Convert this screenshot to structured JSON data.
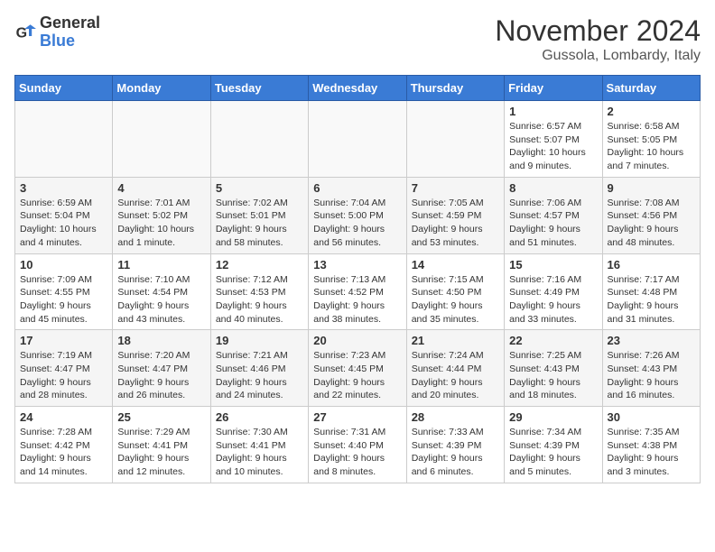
{
  "logo": {
    "line1": "General",
    "line2": "Blue"
  },
  "calendar": {
    "title": "November 2024",
    "subtitle": "Gussola, Lombardy, Italy"
  },
  "headers": [
    "Sunday",
    "Monday",
    "Tuesday",
    "Wednesday",
    "Thursday",
    "Friday",
    "Saturday"
  ],
  "weeks": [
    [
      {
        "day": "",
        "info": ""
      },
      {
        "day": "",
        "info": ""
      },
      {
        "day": "",
        "info": ""
      },
      {
        "day": "",
        "info": ""
      },
      {
        "day": "",
        "info": ""
      },
      {
        "day": "1",
        "info": "Sunrise: 6:57 AM\nSunset: 5:07 PM\nDaylight: 10 hours and 9 minutes."
      },
      {
        "day": "2",
        "info": "Sunrise: 6:58 AM\nSunset: 5:05 PM\nDaylight: 10 hours and 7 minutes."
      }
    ],
    [
      {
        "day": "3",
        "info": "Sunrise: 6:59 AM\nSunset: 5:04 PM\nDaylight: 10 hours and 4 minutes."
      },
      {
        "day": "4",
        "info": "Sunrise: 7:01 AM\nSunset: 5:02 PM\nDaylight: 10 hours and 1 minute."
      },
      {
        "day": "5",
        "info": "Sunrise: 7:02 AM\nSunset: 5:01 PM\nDaylight: 9 hours and 58 minutes."
      },
      {
        "day": "6",
        "info": "Sunrise: 7:04 AM\nSunset: 5:00 PM\nDaylight: 9 hours and 56 minutes."
      },
      {
        "day": "7",
        "info": "Sunrise: 7:05 AM\nSunset: 4:59 PM\nDaylight: 9 hours and 53 minutes."
      },
      {
        "day": "8",
        "info": "Sunrise: 7:06 AM\nSunset: 4:57 PM\nDaylight: 9 hours and 51 minutes."
      },
      {
        "day": "9",
        "info": "Sunrise: 7:08 AM\nSunset: 4:56 PM\nDaylight: 9 hours and 48 minutes."
      }
    ],
    [
      {
        "day": "10",
        "info": "Sunrise: 7:09 AM\nSunset: 4:55 PM\nDaylight: 9 hours and 45 minutes."
      },
      {
        "day": "11",
        "info": "Sunrise: 7:10 AM\nSunset: 4:54 PM\nDaylight: 9 hours and 43 minutes."
      },
      {
        "day": "12",
        "info": "Sunrise: 7:12 AM\nSunset: 4:53 PM\nDaylight: 9 hours and 40 minutes."
      },
      {
        "day": "13",
        "info": "Sunrise: 7:13 AM\nSunset: 4:52 PM\nDaylight: 9 hours and 38 minutes."
      },
      {
        "day": "14",
        "info": "Sunrise: 7:15 AM\nSunset: 4:50 PM\nDaylight: 9 hours and 35 minutes."
      },
      {
        "day": "15",
        "info": "Sunrise: 7:16 AM\nSunset: 4:49 PM\nDaylight: 9 hours and 33 minutes."
      },
      {
        "day": "16",
        "info": "Sunrise: 7:17 AM\nSunset: 4:48 PM\nDaylight: 9 hours and 31 minutes."
      }
    ],
    [
      {
        "day": "17",
        "info": "Sunrise: 7:19 AM\nSunset: 4:47 PM\nDaylight: 9 hours and 28 minutes."
      },
      {
        "day": "18",
        "info": "Sunrise: 7:20 AM\nSunset: 4:47 PM\nDaylight: 9 hours and 26 minutes."
      },
      {
        "day": "19",
        "info": "Sunrise: 7:21 AM\nSunset: 4:46 PM\nDaylight: 9 hours and 24 minutes."
      },
      {
        "day": "20",
        "info": "Sunrise: 7:23 AM\nSunset: 4:45 PM\nDaylight: 9 hours and 22 minutes."
      },
      {
        "day": "21",
        "info": "Sunrise: 7:24 AM\nSunset: 4:44 PM\nDaylight: 9 hours and 20 minutes."
      },
      {
        "day": "22",
        "info": "Sunrise: 7:25 AM\nSunset: 4:43 PM\nDaylight: 9 hours and 18 minutes."
      },
      {
        "day": "23",
        "info": "Sunrise: 7:26 AM\nSunset: 4:43 PM\nDaylight: 9 hours and 16 minutes."
      }
    ],
    [
      {
        "day": "24",
        "info": "Sunrise: 7:28 AM\nSunset: 4:42 PM\nDaylight: 9 hours and 14 minutes."
      },
      {
        "day": "25",
        "info": "Sunrise: 7:29 AM\nSunset: 4:41 PM\nDaylight: 9 hours and 12 minutes."
      },
      {
        "day": "26",
        "info": "Sunrise: 7:30 AM\nSunset: 4:41 PM\nDaylight: 9 hours and 10 minutes."
      },
      {
        "day": "27",
        "info": "Sunrise: 7:31 AM\nSunset: 4:40 PM\nDaylight: 9 hours and 8 minutes."
      },
      {
        "day": "28",
        "info": "Sunrise: 7:33 AM\nSunset: 4:39 PM\nDaylight: 9 hours and 6 minutes."
      },
      {
        "day": "29",
        "info": "Sunrise: 7:34 AM\nSunset: 4:39 PM\nDaylight: 9 hours and 5 minutes."
      },
      {
        "day": "30",
        "info": "Sunrise: 7:35 AM\nSunset: 4:38 PM\nDaylight: 9 hours and 3 minutes."
      }
    ]
  ]
}
